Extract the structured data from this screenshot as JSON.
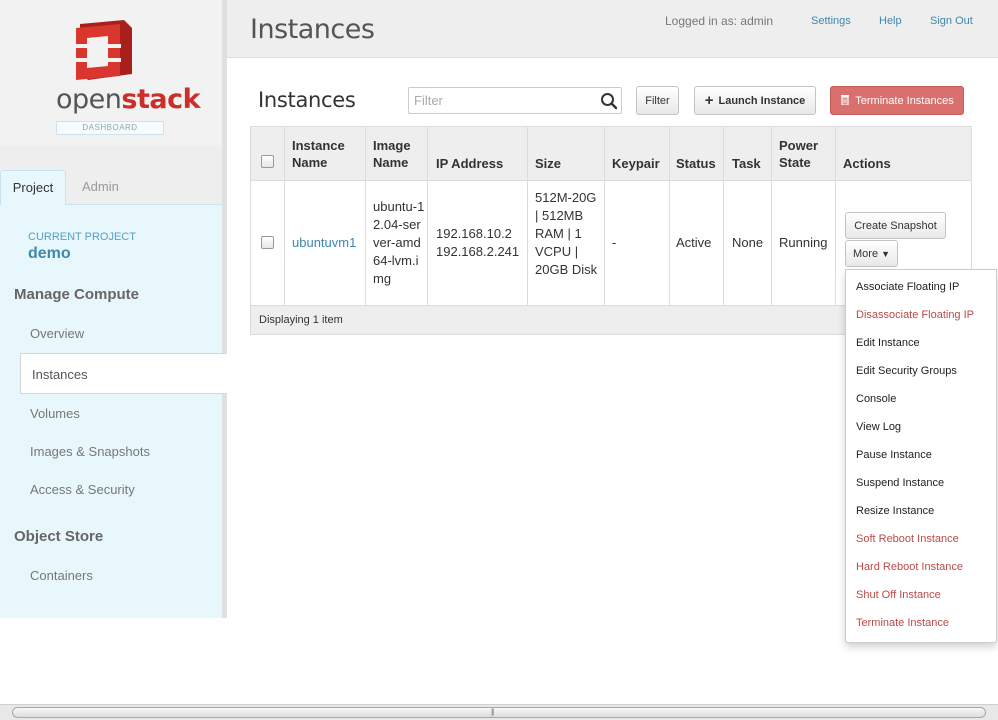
{
  "app": {
    "logo_word_light": "open",
    "logo_word_bold": "stack",
    "logo_subtitle": "DASHBOARD",
    "brand_color": "#cc2f2a"
  },
  "sidebar": {
    "tabs": [
      {
        "label": "Project",
        "active": true
      },
      {
        "label": "Admin",
        "active": false
      }
    ],
    "current_project_label": "CURRENT PROJECT",
    "current_project_name": "demo",
    "sections": [
      {
        "title": "Manage Compute",
        "items": [
          "Overview",
          "Instances",
          "Volumes",
          "Images & Snapshots",
          "Access & Security"
        ]
      },
      {
        "title": "Object Store",
        "items": [
          "Containers"
        ]
      }
    ],
    "active_item": "Instances"
  },
  "header": {
    "title": "Instances",
    "logged_in": "Logged in as: admin",
    "links": [
      "Settings",
      "Help",
      "Sign Out"
    ]
  },
  "toolbar": {
    "table_title": "Instances",
    "filter_placeholder": "Filter",
    "filter_button": "Filter",
    "launch_button": "Launch Instance",
    "terminate_button": "Terminate Instances"
  },
  "table": {
    "columns": [
      "Instance Name",
      "Image Name",
      "IP Address",
      "Size",
      "Keypair",
      "Status",
      "Task",
      "Power State",
      "Actions"
    ],
    "rows": [
      {
        "instance_name": "ubuntuvm1",
        "image_name": "ubuntu-12.04-server-amd64-lvm.img",
        "ip_addresses": [
          "192.168.10.2",
          "192.168.2.241"
        ],
        "size": "512M-20G | 512MB RAM | 1 VCPU | 20GB Disk",
        "keypair": "-",
        "status": "Active",
        "task": "None",
        "power_state": "Running",
        "actions": {
          "primary": "Create Snapshot",
          "more": "More"
        }
      }
    ],
    "footer": "Displaying 1 item"
  },
  "more_menu": [
    {
      "label": "Associate Floating IP",
      "danger": false
    },
    {
      "label": "Disassociate Floating IP",
      "danger": true
    },
    {
      "label": "Edit Instance",
      "danger": false
    },
    {
      "label": "Edit Security Groups",
      "danger": false
    },
    {
      "label": "Console",
      "danger": false
    },
    {
      "label": "View Log",
      "danger": false
    },
    {
      "label": "Pause Instance",
      "danger": false
    },
    {
      "label": "Suspend Instance",
      "danger": false
    },
    {
      "label": "Resize Instance",
      "danger": false
    },
    {
      "label": "Soft Reboot Instance",
      "danger": true
    },
    {
      "label": "Hard Reboot Instance",
      "danger": true
    },
    {
      "label": "Shut Off Instance",
      "danger": true
    },
    {
      "label": "Terminate Instance",
      "danger": true
    }
  ],
  "colors": {
    "link": "#3d88ad",
    "danger": "#b94a48",
    "danger_button": "#d9706d",
    "sidebar_bg": "#e8f7fc"
  }
}
